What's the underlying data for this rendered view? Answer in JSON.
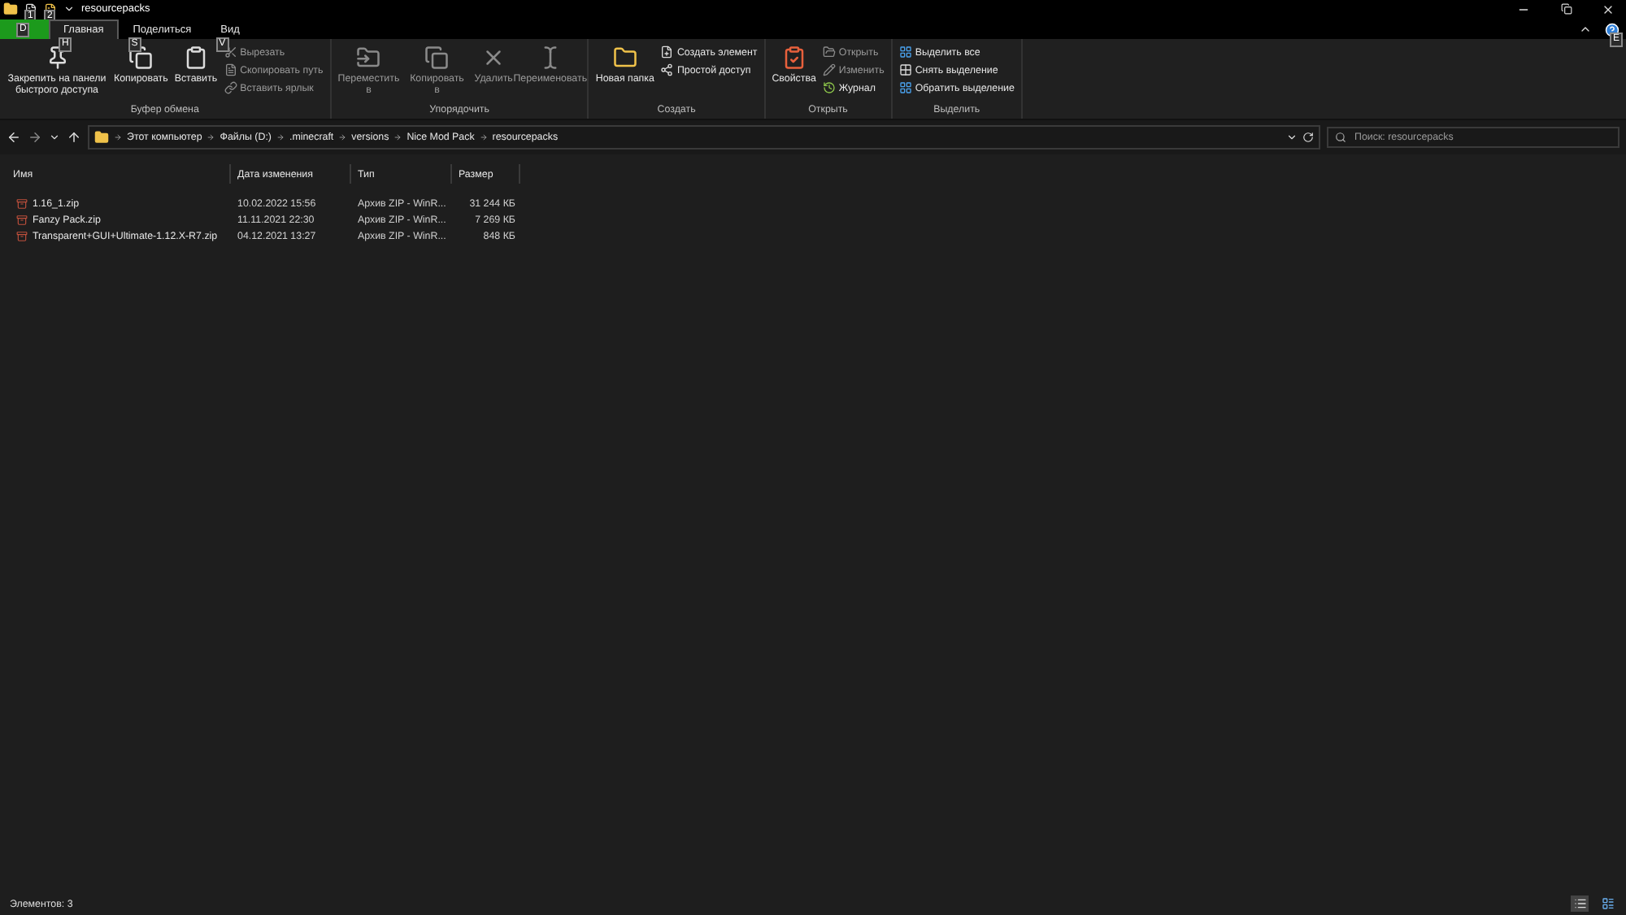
{
  "window": {
    "title": "resourcepacks",
    "help_keytip": "E"
  },
  "quick_access": [
    {
      "keytip": "1"
    },
    {
      "keytip": "2"
    }
  ],
  "tabs": [
    {
      "kind": "file",
      "keytip": "D",
      "selected": false
    },
    {
      "kind": "tab",
      "label": "Главная",
      "keytip": "H",
      "selected": true
    },
    {
      "kind": "tab",
      "label": "Поделиться",
      "keytip": "S",
      "selected": false
    },
    {
      "kind": "tab",
      "label": "Вид",
      "keytip": "V",
      "selected": false
    }
  ],
  "ribbon_groups": [
    {
      "name": "Буфер обмена",
      "commands": [
        {
          "kind": "large",
          "label": "Закрепить на панели быстрого доступа",
          "disabled": false
        },
        {
          "kind": "large",
          "label": "Копировать",
          "disabled": false
        },
        {
          "kind": "large",
          "label": "Вставить",
          "disabled": false
        },
        {
          "kind": "small",
          "label": "Вырезать",
          "disabled": true
        },
        {
          "kind": "small",
          "label": "Скопировать путь",
          "disabled": true
        },
        {
          "kind": "small",
          "label": "Вставить ярлык",
          "disabled": true
        }
      ]
    },
    {
      "name": "Упорядочить",
      "commands": [
        {
          "kind": "large",
          "label": "Переместить в",
          "disabled": true
        },
        {
          "kind": "large",
          "label": "Копировать в",
          "disabled": true
        },
        {
          "kind": "large",
          "label": "Удалить",
          "disabled": true
        },
        {
          "kind": "large",
          "label": "Переименовать",
          "disabled": true
        }
      ]
    },
    {
      "name": "Создать",
      "commands": [
        {
          "kind": "large",
          "label": "Новая папка",
          "disabled": false
        },
        {
          "kind": "small",
          "label": "Создать элемент",
          "disabled": false
        },
        {
          "kind": "small",
          "label": "Простой доступ",
          "disabled": false
        }
      ]
    },
    {
      "name": "Открыть",
      "commands": [
        {
          "kind": "large",
          "label": "Свойства",
          "disabled": false
        },
        {
          "kind": "small",
          "label": "Открыть",
          "disabled": true
        },
        {
          "kind": "small",
          "label": "Изменить",
          "disabled": true
        },
        {
          "kind": "small",
          "label": "Журнал",
          "disabled": false
        }
      ]
    },
    {
      "name": "Выделить",
      "commands": [
        {
          "kind": "small",
          "label": "Выделить все",
          "disabled": false
        },
        {
          "kind": "small",
          "label": "Снять выделение",
          "disabled": false
        },
        {
          "kind": "small",
          "label": "Обратить выделение",
          "disabled": false
        }
      ]
    }
  ],
  "breadcrumbs": [
    "Этот компьютер",
    "Файлы (D:)",
    ".minecraft",
    "versions",
    "Nice Mod Pack",
    "resourcepacks"
  ],
  "search": {
    "placeholder": "Поиск: resourcepacks"
  },
  "table": {
    "columns": [
      "Имя",
      "Дата изменения",
      "Тип",
      "Размер"
    ],
    "rows": [
      {
        "name": "1.16_1.zip",
        "date": "10.02.2022 15:56",
        "type": "Архив ZIP - WinR...",
        "size": "31 244 КБ"
      },
      {
        "name": "Fanzy Pack.zip",
        "date": "11.11.2021 22:30",
        "type": "Архив ZIP - WinR...",
        "size": "7 269 КБ"
      },
      {
        "name": "Transparent+GUI+Ultimate-1.12.X-R7.zip",
        "date": "04.12.2021 13:27",
        "type": "Архив ZIP - WinR...",
        "size": "848 КБ"
      }
    ]
  },
  "status_bar": {
    "text": "Элементов: 3"
  }
}
